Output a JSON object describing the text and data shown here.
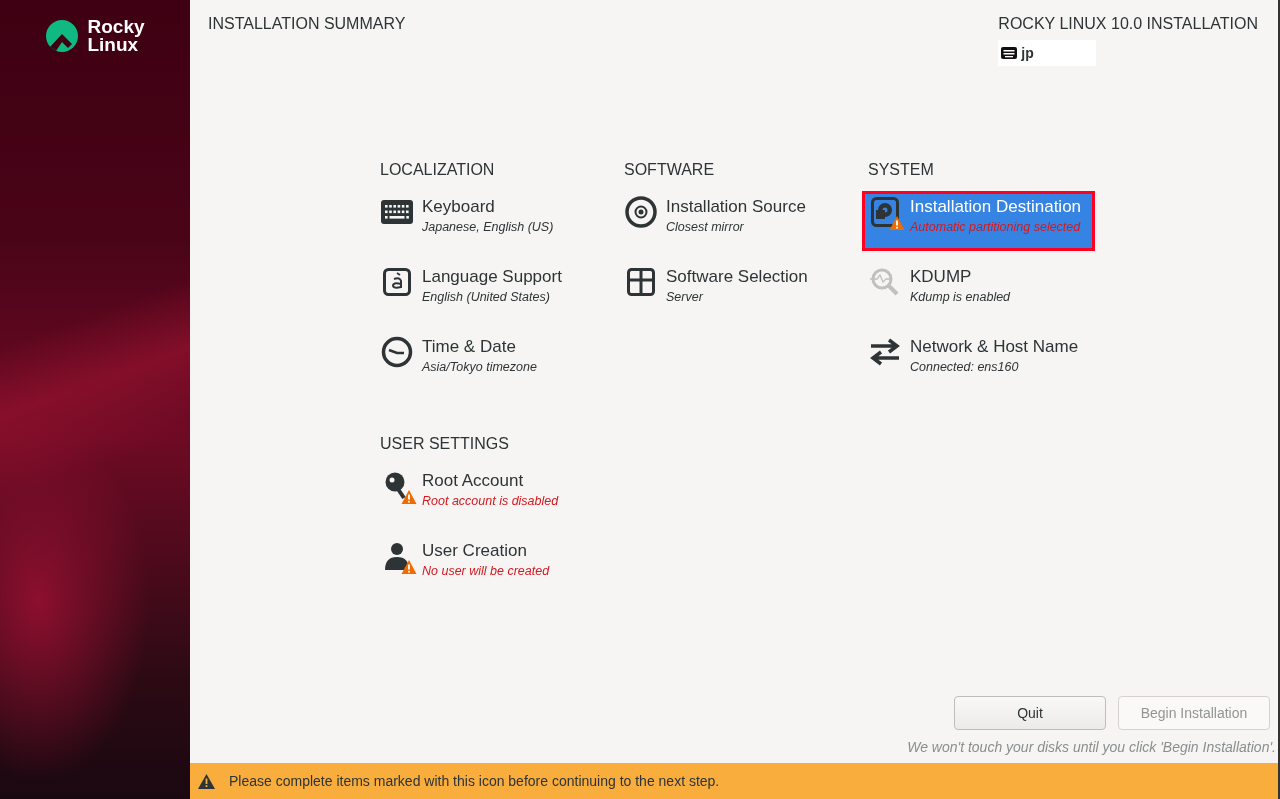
{
  "brand": {
    "lines": [
      "Rocky",
      "Linux"
    ]
  },
  "header": {
    "title": "INSTALLATION SUMMARY",
    "product": "ROCKY LINUX 10.0 INSTALLATION",
    "keyboard_layout": "jp"
  },
  "columns": [
    {
      "sections": [
        {
          "title": "LOCALIZATION",
          "items": [
            {
              "kind": "keyboard",
              "title": "Keyboard",
              "status": "Japanese, English (US)",
              "warning": false,
              "selected": false
            },
            {
              "kind": "language",
              "title": "Language Support",
              "status": "English (United States)",
              "warning": false,
              "selected": false
            },
            {
              "kind": "clock",
              "title": "Time & Date",
              "status": "Asia/Tokyo timezone",
              "warning": false,
              "selected": false
            }
          ]
        },
        {
          "title": "USER SETTINGS",
          "items": [
            {
              "kind": "root",
              "title": "Root Account",
              "status": "Root account is disabled",
              "warning": true,
              "selected": false
            },
            {
              "kind": "user",
              "title": "User Creation",
              "status": "No user will be created",
              "warning": true,
              "selected": false
            }
          ]
        }
      ]
    },
    {
      "sections": [
        {
          "title": "SOFTWARE",
          "items": [
            {
              "kind": "source",
              "title": "Installation Source",
              "status": "Closest mirror",
              "warning": false,
              "selected": false
            },
            {
              "kind": "software",
              "title": "Software Selection",
              "status": "Server",
              "warning": false,
              "selected": false
            }
          ]
        }
      ]
    },
    {
      "sections": [
        {
          "title": "SYSTEM",
          "items": [
            {
              "kind": "disk",
              "title": "Installation Destination",
              "status": "Automatic partitioning selected",
              "warning": true,
              "selected": true
            },
            {
              "kind": "kdump",
              "title": "KDUMP",
              "status": "Kdump is enabled",
              "warning": false,
              "selected": false
            },
            {
              "kind": "network",
              "title": "Network & Host Name",
              "status": "Connected: ens160",
              "warning": false,
              "selected": false
            }
          ]
        }
      ]
    }
  ],
  "buttons": [
    {
      "label": "Quit",
      "disabled": false
    },
    {
      "label": "Begin Installation",
      "disabled": true
    }
  ],
  "footer_note": "We won't touch your disks until you click 'Begin Installation'.",
  "warning_bar": "Please complete items marked with this icon before continuing to the next step."
}
